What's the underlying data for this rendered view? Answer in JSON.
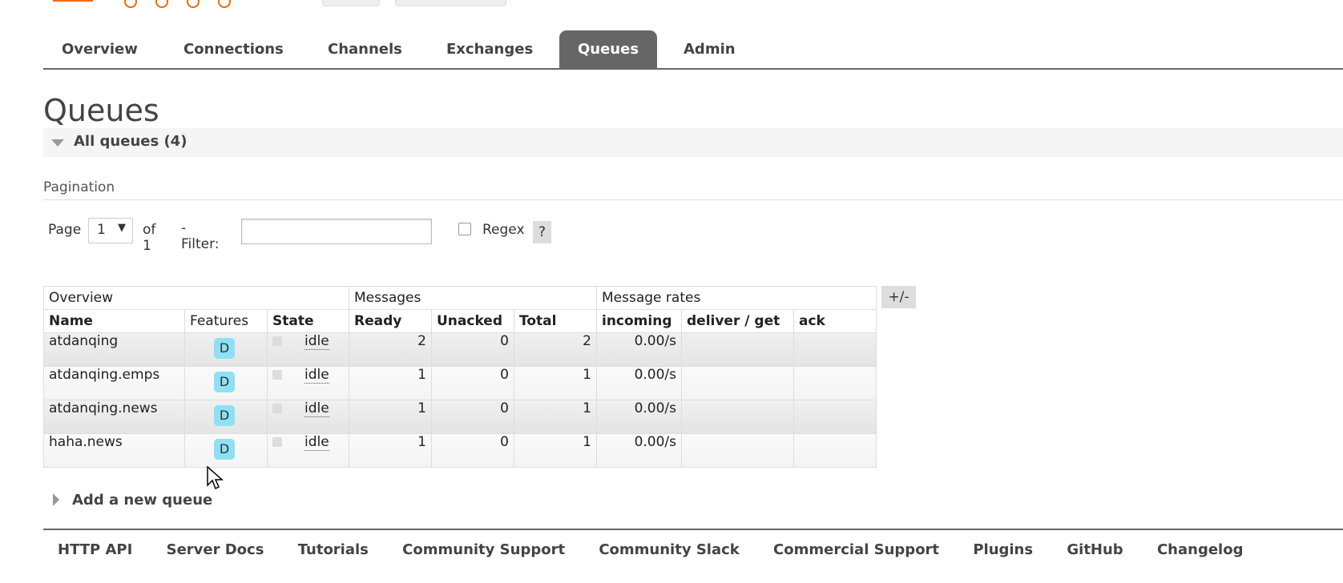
{
  "nav": {
    "tabs": [
      {
        "label": "Overview"
      },
      {
        "label": "Connections"
      },
      {
        "label": "Channels"
      },
      {
        "label": "Exchanges"
      },
      {
        "label": "Queues",
        "active": true
      },
      {
        "label": "Admin"
      }
    ]
  },
  "page": {
    "title": "Queues"
  },
  "section": {
    "label": "All queues (4)"
  },
  "pagination": {
    "title": "Pagination",
    "page_label": "Page",
    "page_value": "1",
    "of_label": "of 1",
    "filter_label": "- Filter:",
    "filter_value": "",
    "regex_label": "Regex",
    "help_label": "?"
  },
  "table": {
    "groups": [
      "Overview",
      "Messages",
      "Message rates"
    ],
    "toggle_label": "+/-",
    "columns": [
      "Name",
      "Features",
      "State",
      "Ready",
      "Unacked",
      "Total",
      "incoming",
      "deliver / get",
      "ack"
    ],
    "rows": [
      {
        "name": "atdanqing",
        "feature": "D",
        "state": "idle",
        "ready": "2",
        "unacked": "0",
        "total": "2",
        "incoming": "0.00/s",
        "deliver": "",
        "ack": ""
      },
      {
        "name": "atdanqing.emps",
        "feature": "D",
        "state": "idle",
        "ready": "1",
        "unacked": "0",
        "total": "1",
        "incoming": "0.00/s",
        "deliver": "",
        "ack": ""
      },
      {
        "name": "atdanqing.news",
        "feature": "D",
        "state": "idle",
        "ready": "1",
        "unacked": "0",
        "total": "1",
        "incoming": "0.00/s",
        "deliver": "",
        "ack": ""
      },
      {
        "name": "haha.news",
        "feature": "D",
        "state": "idle",
        "ready": "1",
        "unacked": "0",
        "total": "1",
        "incoming": "0.00/s",
        "deliver": "",
        "ack": ""
      }
    ]
  },
  "add_queue": {
    "label": "Add a new queue"
  },
  "footer": {
    "links": [
      "HTTP API",
      "Server Docs",
      "Tutorials",
      "Community Support",
      "Community Slack",
      "Commercial Support",
      "Plugins",
      "GitHub",
      "Changelog"
    ]
  },
  "colors": {
    "accent": "#ff6600",
    "tab_active": "#666666",
    "badge": "#8ee0f5"
  }
}
